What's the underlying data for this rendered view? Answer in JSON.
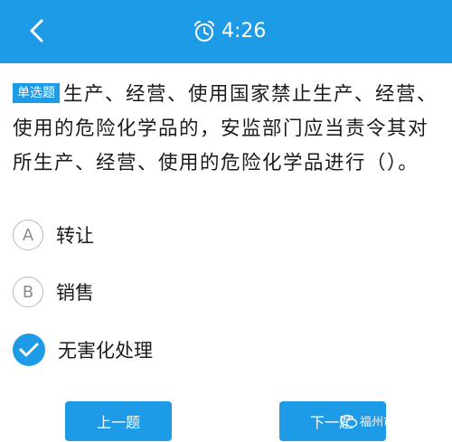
{
  "header": {
    "time": "4:26",
    "bg_color": "#1e9be6"
  },
  "question": {
    "type_badge": "单选题",
    "text": "生产、经营、使用国家禁止生产、经营、使用的危险化学品的，安监部门应当责令其对所生产、经营、使用的危险化学品进行（）。"
  },
  "options": [
    {
      "letter": "A",
      "label": "转让",
      "selected": false
    },
    {
      "letter": "B",
      "label": "销售",
      "selected": false
    },
    {
      "letter": "C",
      "label": "无害化处理",
      "selected": true
    }
  ],
  "buttons": {
    "prev_label": "上一题",
    "next_label": "下一题"
  },
  "watermark": {
    "text": "福州市教场小学"
  }
}
